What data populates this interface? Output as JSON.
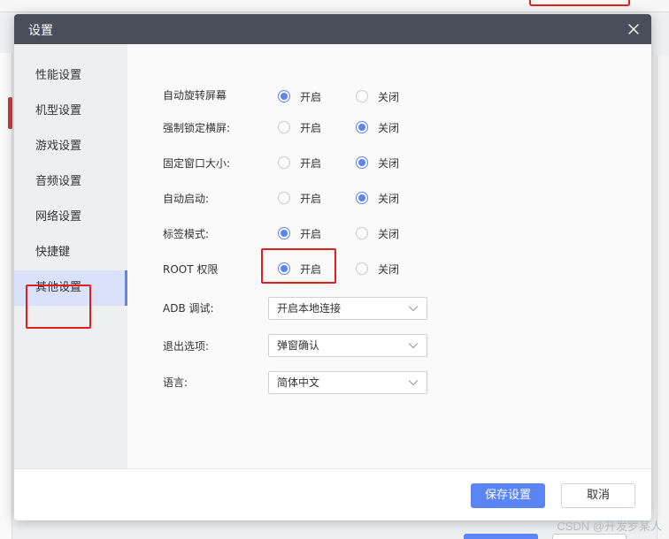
{
  "background": {
    "watermark": "CSDN @开发罗某人"
  },
  "dialog": {
    "title": "设置",
    "sidebar": {
      "items": [
        {
          "label": "性能设置",
          "active": false
        },
        {
          "label": "机型设置",
          "active": false
        },
        {
          "label": "游戏设置",
          "active": false
        },
        {
          "label": "音频设置",
          "active": false
        },
        {
          "label": "网络设置",
          "active": false
        },
        {
          "label": "快捷键",
          "active": false
        },
        {
          "label": "其他设置",
          "active": true
        }
      ]
    },
    "settings": {
      "radio_rows": [
        {
          "label": "自动旋转屏幕",
          "on_label": "开启",
          "off_label": "关闭",
          "selected": "on"
        },
        {
          "label": "强制锁定横屏:",
          "on_label": "开启",
          "off_label": "关闭",
          "selected": "off"
        },
        {
          "label": "固定窗口大小:",
          "on_label": "开启",
          "off_label": "关闭",
          "selected": "off"
        },
        {
          "label": "自动启动:",
          "on_label": "开启",
          "off_label": "关闭",
          "selected": "off"
        },
        {
          "label": "标签模式:",
          "on_label": "开启",
          "off_label": "关闭",
          "selected": "on"
        },
        {
          "label": "ROOT 权限",
          "on_label": "开启",
          "off_label": "关闭",
          "selected": "on"
        }
      ],
      "select_rows": [
        {
          "label": "ADB 调试:",
          "value": "开启本地连接"
        },
        {
          "label": "退出选项:",
          "value": "弹窗确认"
        },
        {
          "label": "语言:",
          "value": "简体中文"
        }
      ]
    },
    "footer": {
      "save_label": "保存设置",
      "cancel_label": "取消"
    }
  },
  "colors": {
    "accent": "#5b84f6",
    "header": "#4a4e5a",
    "highlight": "#e02020"
  }
}
